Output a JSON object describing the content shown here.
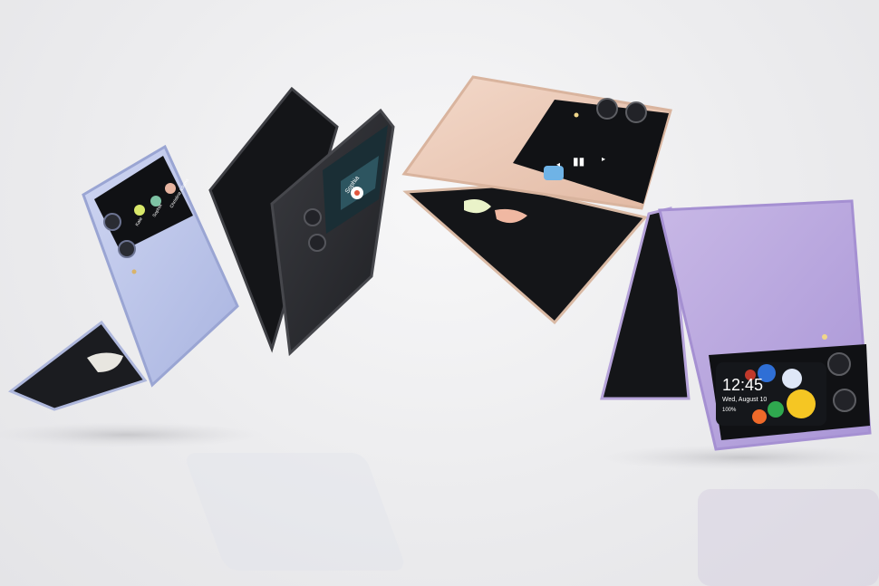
{
  "colors": {
    "background": "#ececee",
    "blue_phone": "#b9c3e8",
    "graphite_phone": "#2b2c30",
    "pink_gold_phone": "#ecc9b5",
    "bora_purple_phone": "#b9a6dc"
  },
  "phones": [
    {
      "name": "blue-flip-phone",
      "cover_contacts": [
        "Kate",
        "Sophia",
        "Christina Adams"
      ]
    },
    {
      "name": "graphite-flip-phone",
      "cover_caller": "Sophia"
    },
    {
      "name": "pink-gold-flip-phone",
      "cover_media": "music-controls"
    },
    {
      "name": "bora-purple-flip-phone",
      "cover_time": "12:45",
      "cover_date": "Wed, August 10",
      "cover_battery": "100%"
    }
  ]
}
